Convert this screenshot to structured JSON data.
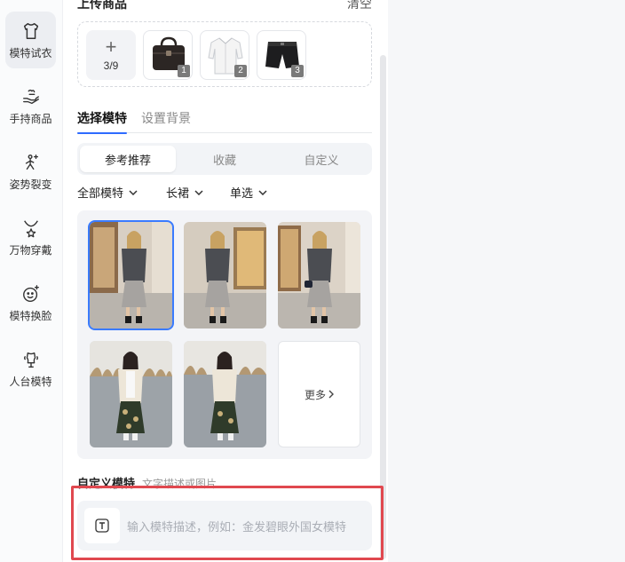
{
  "sidebar": {
    "items": [
      {
        "label": "模特试衣",
        "icon": "tshirt-icon",
        "active": true
      },
      {
        "label": "手持商品",
        "icon": "hand-holding-icon",
        "active": false
      },
      {
        "label": "姿势裂变",
        "icon": "pose-icon",
        "active": false
      },
      {
        "label": "万物穿戴",
        "icon": "necklace-icon",
        "active": false
      },
      {
        "label": "模特换脸",
        "icon": "face-swap-icon",
        "active": false
      },
      {
        "label": "人台模特",
        "icon": "mannequin-icon",
        "active": false
      }
    ]
  },
  "upload": {
    "title": "上传商品",
    "clear_label": "清空",
    "add_plus": "+",
    "count": "3/9",
    "products": [
      {
        "name": "handbag",
        "badge": "1"
      },
      {
        "name": "white-shirt",
        "badge": "2"
      },
      {
        "name": "black-shorts",
        "badge": "3"
      }
    ]
  },
  "tabs": [
    {
      "label": "选择模特",
      "active": true
    },
    {
      "label": "设置背景",
      "active": false
    }
  ],
  "segments": [
    {
      "label": "参考推荐",
      "active": true
    },
    {
      "label": "收藏",
      "active": false
    },
    {
      "label": "自定义",
      "active": false
    }
  ],
  "filters": [
    {
      "label": "全部模特"
    },
    {
      "label": "长裙"
    },
    {
      "label": "单选"
    }
  ],
  "models": {
    "more_label": "更多",
    "more_icon": "chevron-right-icon"
  },
  "custom": {
    "title": "自定义模特",
    "subtitle": "文字描述或图片",
    "placeholder": "输入模特描述，例如：金发碧眼外国女模特",
    "input_icon": "text-t-icon"
  },
  "colors": {
    "accent": "#2e6bff",
    "highlight": "#e0484f"
  }
}
